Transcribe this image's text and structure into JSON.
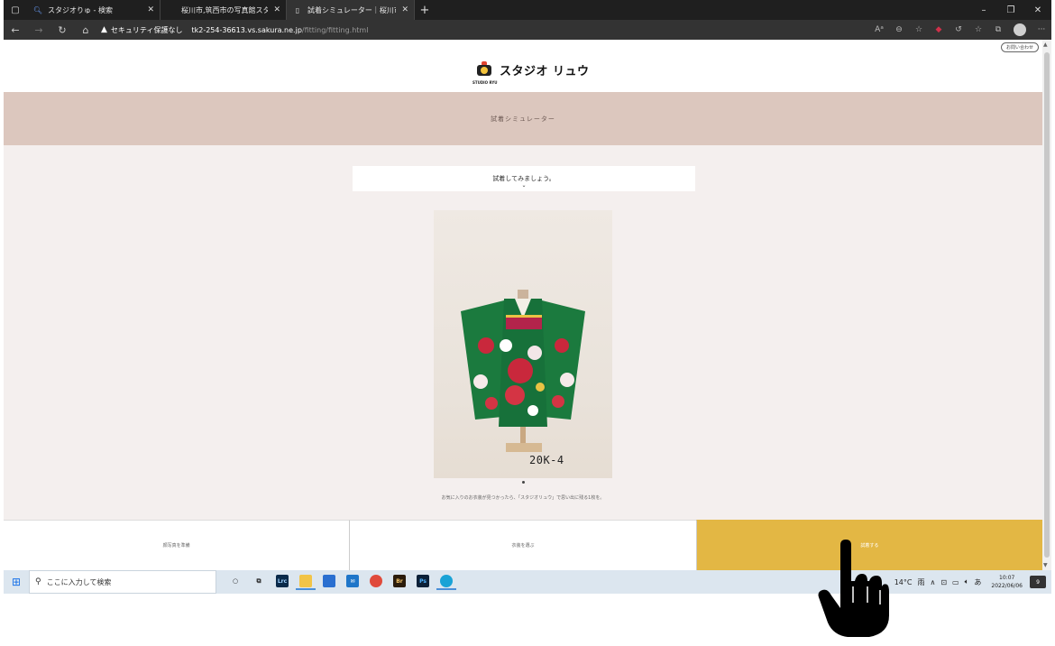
{
  "browser": {
    "tabs": [
      {
        "title": "スタジオりゅ - 検索",
        "active": false
      },
      {
        "title": "桜川市,筑西市の写真館スタジオリュ",
        "active": false
      },
      {
        "title": "試着シミュレーター｜桜川市,筑西市の",
        "active": true
      }
    ],
    "address": {
      "security_label": "セキュリティ保護なし",
      "host": "tk2-254-36613.vs.sakura.ne.jp",
      "path": "/fitting/fitting.html"
    }
  },
  "page": {
    "inquiry_button": "お問い合わせ",
    "logo": {
      "name": "スタジオ リュウ",
      "sub": "STUDIO RYU"
    },
    "banner_title": "試着シミュレーター",
    "intro": {
      "text": "試着してみましょう。",
      "chevron": "⌄"
    },
    "photo": {
      "code": "20K-4"
    },
    "notice": "お気に入りのお衣装が見つかったら、「スタジオリュウ」で思い出に残る1枚を。",
    "actions": [
      {
        "label": "顔写真を準備",
        "primary": false
      },
      {
        "label": "衣装を選ぶ",
        "primary": false
      },
      {
        "label": "試着する",
        "primary": true
      }
    ]
  },
  "taskbar": {
    "search_placeholder": "ここに入力して検索",
    "apps": [
      "Lrc",
      "Br",
      "Ps"
    ],
    "weather": "14°C",
    "weather_cond": "雨",
    "ime": "あ",
    "time": "10:07",
    "date": "2022/06/06",
    "notification_count": "9"
  },
  "colors": {
    "banner": "#dcc7be",
    "primary_action": "#e3b744",
    "page_bg": "#f4efee",
    "kimono_green": "#1b7a3e"
  }
}
